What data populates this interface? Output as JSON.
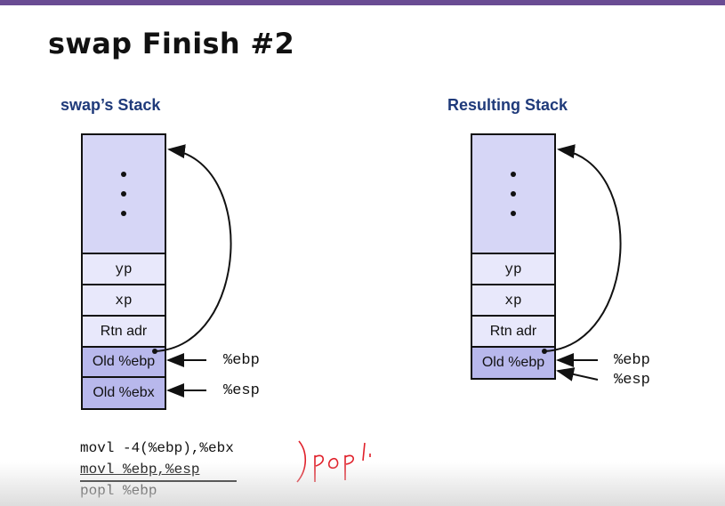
{
  "slide": {
    "title": "swap Finish #2"
  },
  "left_stack": {
    "heading": "swap’s Stack",
    "cells": [
      "yp",
      "xp",
      "Rtn adr",
      "Old %ebp",
      "Old %ebx"
    ],
    "pointers": [
      "%ebp",
      "%esp"
    ]
  },
  "right_stack": {
    "heading": "Resulting Stack",
    "cells": [
      "yp",
      "xp",
      "Rtn adr",
      "Old %ebp"
    ],
    "pointers": [
      "%ebp",
      "%esp"
    ]
  },
  "code": {
    "lines": [
      "movl -4(%ebp),%ebx",
      "movl %ebp,%esp",
      "popl %ebp"
    ]
  },
  "handwriting": {
    "text": ")popl"
  },
  "colors": {
    "accent_bar": "#6a4c93",
    "heading": "#1f3a7a",
    "stack_light": "#e8e8fb",
    "stack_frame": "#b8b8ec",
    "annotation_red": "#e0202a"
  }
}
